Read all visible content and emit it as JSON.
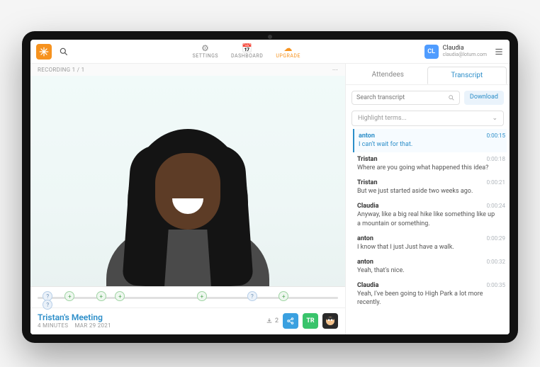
{
  "nav": {
    "items": [
      {
        "label": "SETTINGS"
      },
      {
        "label": "DASHBOARD"
      },
      {
        "label": "UPGRADE"
      }
    ]
  },
  "user": {
    "initials": "CL",
    "name": "Claudia",
    "email": "claudia@lotum.com"
  },
  "recording": {
    "label": "RECORDING 1 / 1"
  },
  "meeting": {
    "title": "Tristan's Meeting",
    "duration_label": "4 MINUTES",
    "date_label": "MAR 29 2021",
    "attendee_count": "2",
    "tr_label": "TR"
  },
  "panel": {
    "tab_attendees": "Attendees",
    "tab_transcript": "Transcript",
    "search_placeholder": "Search transcript",
    "download_label": "Download",
    "highlight_placeholder": "Highlight terms..."
  },
  "transcript": [
    {
      "speaker": "anton",
      "time": "0:00:15",
      "text": "I can't wait for that.",
      "active": true
    },
    {
      "speaker": "Tristan",
      "time": "0:00:18",
      "text": "Where are you going what happened this idea?"
    },
    {
      "speaker": "Tristan",
      "time": "0:00:21",
      "text": "But we just started aside two weeks ago."
    },
    {
      "speaker": "Claudia",
      "time": "0:00:24",
      "text": "Anyway, like a big real hike like something like up a mountain or something."
    },
    {
      "speaker": "anton",
      "time": "0:00:29",
      "text": "I know that I just Just have a walk."
    },
    {
      "speaker": "anton",
      "time": "0:00:32",
      "text": "Yeah, that's nice."
    },
    {
      "speaker": "Claudia",
      "time": "0:00:35",
      "text": "Yeah, I've been going to High Park a lot more recently."
    }
  ],
  "timeline": {
    "markers": [
      {
        "pos": 3,
        "kind": "q"
      },
      {
        "pos": 3,
        "kind": "q",
        "row": 2
      },
      {
        "pos": 10,
        "kind": "g"
      },
      {
        "pos": 20,
        "kind": "g"
      },
      {
        "pos": 26,
        "kind": "g"
      },
      {
        "pos": 52,
        "kind": "g"
      },
      {
        "pos": 68,
        "kind": "q"
      },
      {
        "pos": 78,
        "kind": "g"
      }
    ]
  }
}
